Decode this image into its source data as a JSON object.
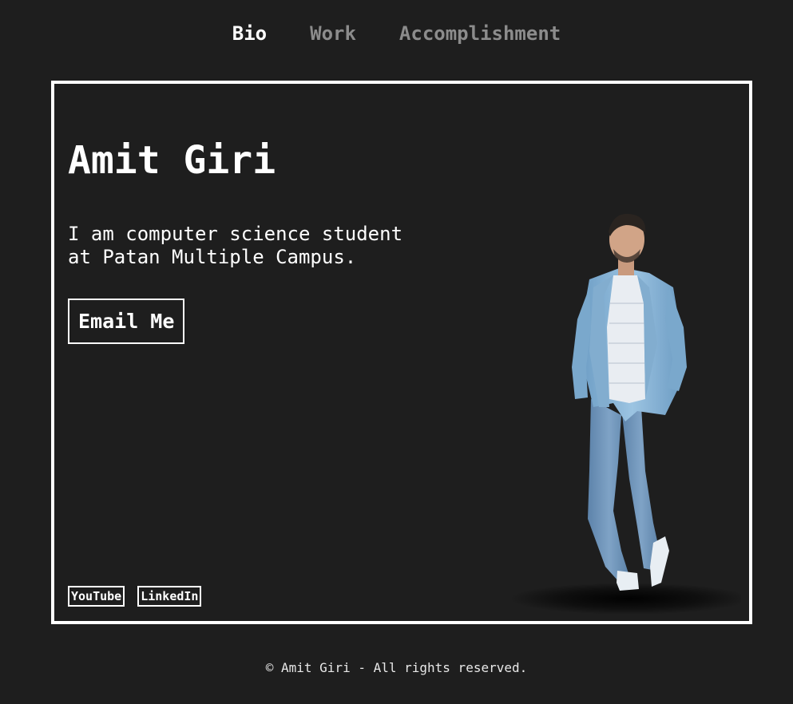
{
  "nav": {
    "items": [
      {
        "label": "Bio",
        "active": true
      },
      {
        "label": "Work",
        "active": false
      },
      {
        "label": "Accomplishment",
        "active": false
      }
    ]
  },
  "hero": {
    "name": "Amit Giri",
    "bio": "I am computer science student at Patan Multiple Campus.",
    "email_button": "Email Me"
  },
  "social": {
    "youtube": "YouTube",
    "linkedin": "LinkedIn"
  },
  "footer": {
    "copyright": "© Amit Giri - All rights reserved."
  },
  "colors": {
    "background": "#1e1e1e",
    "text": "#ffffff",
    "nav_inactive": "#8c8c8c",
    "jacket": "#8ab6d8",
    "jeans": "#6f93b8"
  }
}
